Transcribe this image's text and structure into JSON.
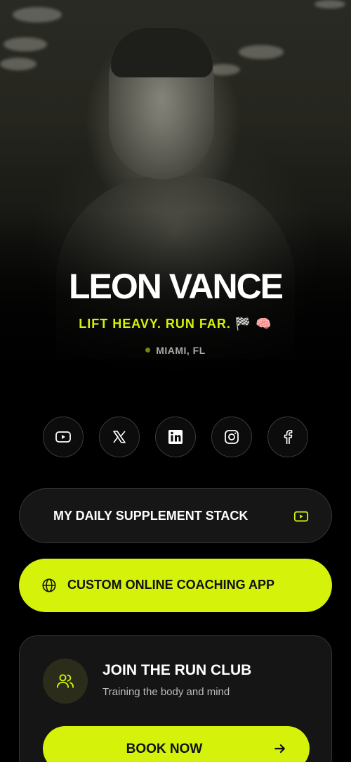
{
  "profile": {
    "name": "LEON VANCE",
    "tagline": "LIFT HEAVY. RUN FAR. 🏁 🧠",
    "location": "MIAMI, FL"
  },
  "socials": [
    {
      "icon": "youtube-icon"
    },
    {
      "icon": "x-icon"
    },
    {
      "icon": "linkedin-icon"
    },
    {
      "icon": "instagram-icon"
    },
    {
      "icon": "facebook-icon"
    }
  ],
  "links": {
    "supplement": {
      "label": "MY DAILY SUPPLEMENT STACK",
      "icon": "youtube-icon"
    },
    "coaching": {
      "label": "CUSTOM ONLINE COACHING APP",
      "icon": "globe-icon"
    }
  },
  "run_club": {
    "title": "JOIN THE RUN CLUB",
    "subtitle": "Training the body and mind",
    "button_label": "BOOK NOW",
    "icon": "users-icon"
  },
  "colors": {
    "accent": "#d4f20a",
    "background": "#000000",
    "card": "#151515"
  }
}
